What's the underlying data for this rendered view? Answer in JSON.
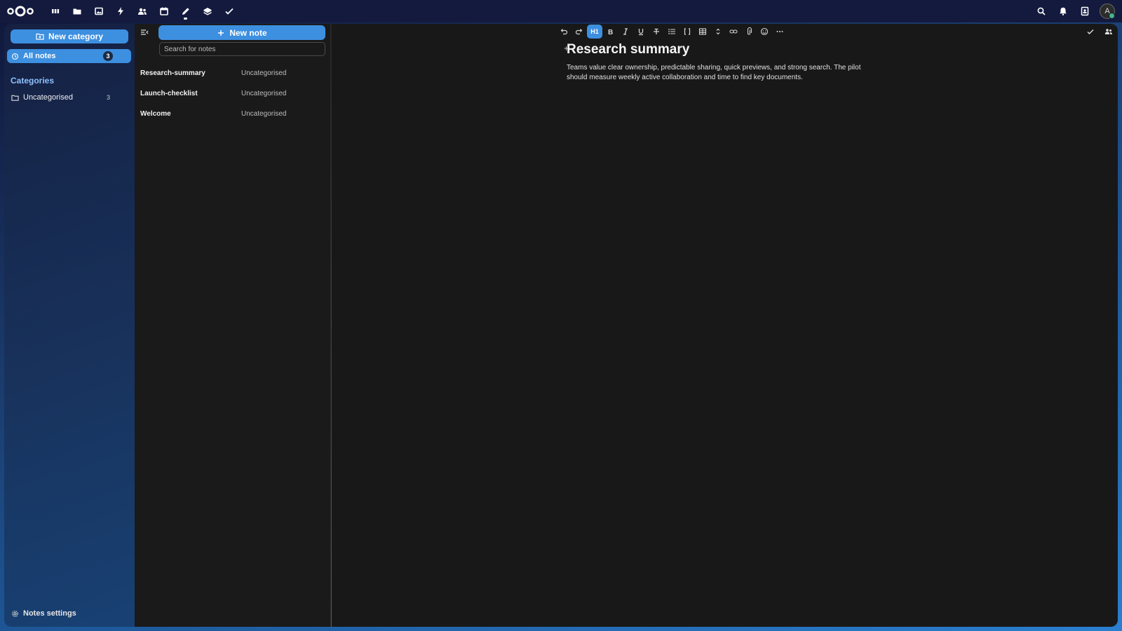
{
  "topbar": {
    "apps": [
      {
        "name": "dashboard-app",
        "icon": "dashboard-icon"
      },
      {
        "name": "files-app",
        "icon": "folder-icon"
      },
      {
        "name": "photos-app",
        "icon": "image-icon"
      },
      {
        "name": "activity-app",
        "icon": "bolt-icon"
      },
      {
        "name": "contacts-app",
        "icon": "contacts-icon"
      },
      {
        "name": "calendar-app",
        "icon": "calendar-icon"
      },
      {
        "name": "notes-app",
        "icon": "pencil-icon"
      },
      {
        "name": "deck-app",
        "icon": "stack-icon"
      },
      {
        "name": "tasks-app",
        "icon": "check-icon"
      }
    ],
    "active_app": "notes-app",
    "avatar_initial": "A"
  },
  "nav": {
    "new_category_label": "New category",
    "all_notes_label": "All notes",
    "all_notes_count": "3",
    "categories_heading": "Categories",
    "categories": [
      {
        "label": "Uncategorised",
        "count": "3"
      }
    ],
    "settings_label": "Notes settings"
  },
  "list": {
    "new_note_label": "New note",
    "search_placeholder": "Search for notes",
    "notes": [
      {
        "title": "Research-summary",
        "category": "Uncategorised"
      },
      {
        "title": "Launch-checklist",
        "category": "Uncategorised"
      },
      {
        "title": "Welcome",
        "category": "Uncategorised"
      }
    ]
  },
  "editor": {
    "heading_button_label": "H1",
    "title": "Research summary",
    "body": "Teams value clear ownership, predictable sharing, quick previews, and strong search. The pilot should measure weekly active collaboration and time to find key documents."
  },
  "colors": {
    "accent": "#3d8fe0",
    "topbar": "#141a3e",
    "panel": "#1a1a1a",
    "editor": "#181818"
  }
}
